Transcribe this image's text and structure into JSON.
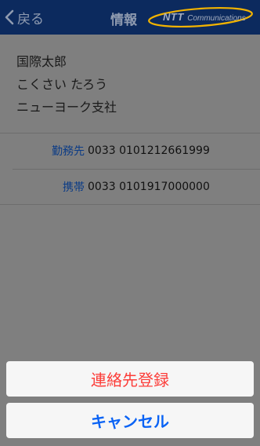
{
  "navbar": {
    "back_label": "戻る",
    "title": "情報",
    "logo": {
      "brand": "NTT",
      "sub": "Communications"
    }
  },
  "contact": {
    "name": "国際太郎",
    "reading": "こくさい たろう",
    "office": "ニューヨーク支社"
  },
  "phones": [
    {
      "label": "勤務先",
      "number": "0033 0101212661999"
    },
    {
      "label": "携帯",
      "number": "0033 0101917000000"
    }
  ],
  "action_sheet": {
    "register_label": "連絡先登録",
    "cancel_label": "キャンセル"
  },
  "colors": {
    "navbar": "#0c2a5e",
    "destructive": "#fc3d39",
    "cancel": "#0a63f5",
    "label": "#0c3c86",
    "logo_swoosh": "#f2b300"
  }
}
